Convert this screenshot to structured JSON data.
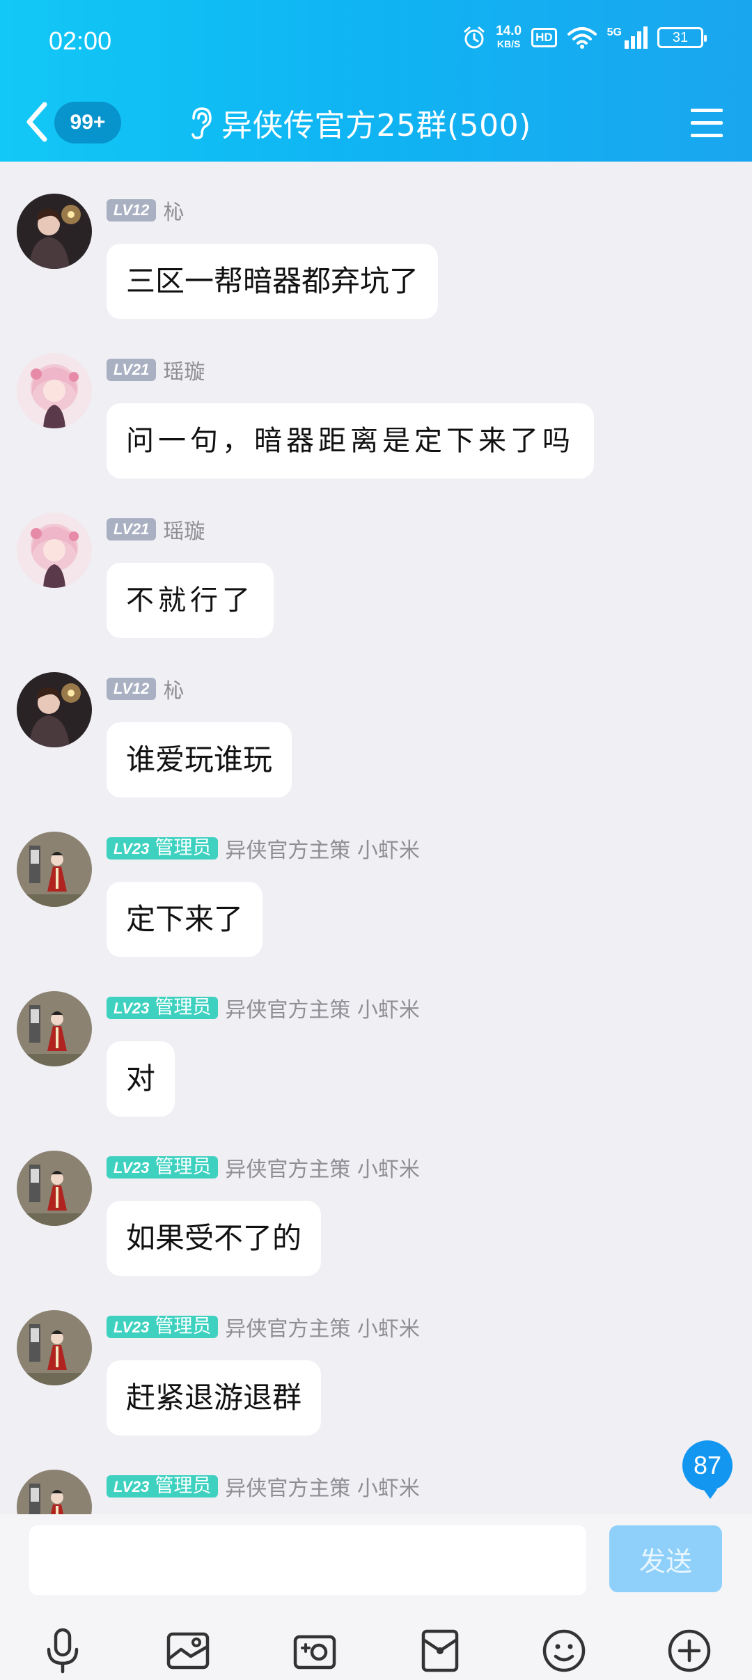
{
  "status_bar": {
    "time": "02:00",
    "net_speed_value": "14.0",
    "net_speed_unit": "KB/S",
    "hd_label": "HD",
    "network_label": "5G",
    "battery": "31",
    "icons": [
      "alarm-icon",
      "wifi-icon",
      "signal-icon",
      "battery-icon"
    ]
  },
  "nav": {
    "unread_badge": "99+",
    "title": "异侠传官方25群(500)",
    "icons": [
      "back-icon",
      "ear-icon",
      "menu-icon"
    ]
  },
  "messages": [
    {
      "level": "LV12",
      "role": "",
      "nick": "杺",
      "text": "三区一帮暗器都弃坑了",
      "avatar": "avatar-boy-lantern",
      "handwriting": false
    },
    {
      "level": "LV21",
      "role": "",
      "nick": "瑶璇",
      "text": "问一句，暗器距离是定下来了吗",
      "avatar": "avatar-girl-pink",
      "handwriting": true
    },
    {
      "level": "LV21",
      "role": "",
      "nick": "瑶璇",
      "text": "不就行了",
      "avatar": "avatar-girl-pink",
      "handwriting": true
    },
    {
      "level": "LV12",
      "role": "",
      "nick": "杺",
      "text": "谁爱玩谁玩",
      "avatar": "avatar-boy-lantern",
      "handwriting": false
    },
    {
      "level": "LV23",
      "role": "管理员",
      "nick": "异侠官方主策 小虾米",
      "text": "定下来了",
      "avatar": "avatar-admin-redrobe",
      "handwriting": false
    },
    {
      "level": "LV23",
      "role": "管理员",
      "nick": "异侠官方主策 小虾米",
      "text": "对",
      "avatar": "avatar-admin-redrobe",
      "handwriting": false
    },
    {
      "level": "LV23",
      "role": "管理员",
      "nick": "异侠官方主策 小虾米",
      "text": "如果受不了的",
      "avatar": "avatar-admin-redrobe",
      "handwriting": false
    },
    {
      "level": "LV23",
      "role": "管理员",
      "nick": "异侠官方主策 小虾米",
      "text": "赶紧退游退群",
      "avatar": "avatar-admin-redrobe",
      "handwriting": false
    },
    {
      "level": "LV23",
      "role": "管理员",
      "nick": "异侠官方主策 小虾米",
      "text": "",
      "avatar": "avatar-admin-redrobe",
      "handwriting": false
    }
  ],
  "new_message_count": "87",
  "composer": {
    "input_value": "",
    "send_label": "发送"
  },
  "toolbar_icons": [
    "microphone-icon",
    "image-icon",
    "camera-icon",
    "red-packet-icon",
    "emoji-icon",
    "plus-icon"
  ],
  "colors": {
    "header_start": "#12c8f6",
    "header_end": "#1aa6ef",
    "admin_badge": "#3ed1c0",
    "level_badge": "#a9b0c2",
    "send_button": "#8fd0fb",
    "new_count_bubble": "#1296f0"
  }
}
